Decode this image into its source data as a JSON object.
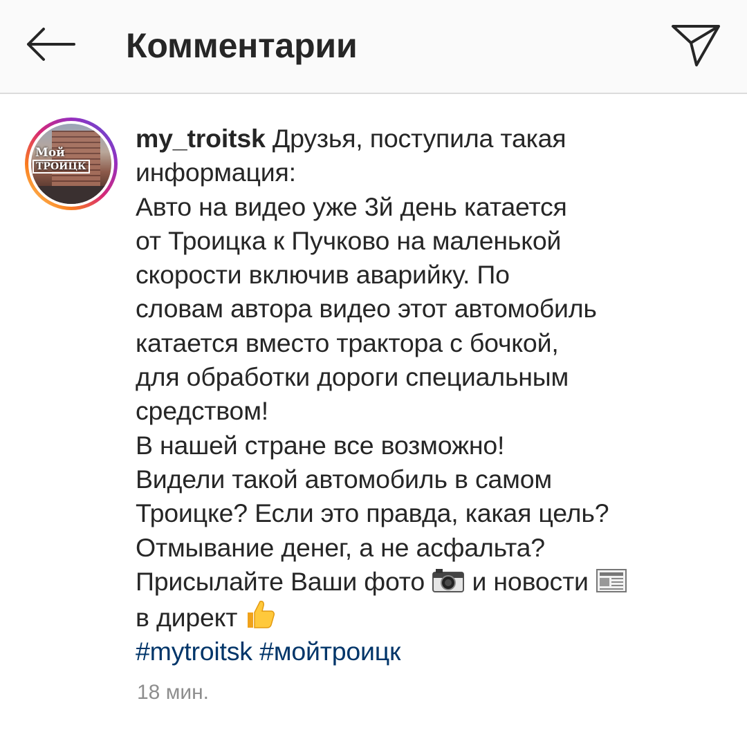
{
  "header": {
    "title": "Комментарии",
    "back_icon": "arrow-left-icon",
    "share_icon": "paper-plane-icon"
  },
  "avatar": {
    "logo_top": "Мой",
    "logo_bottom": "ТРОИЦК"
  },
  "comment": {
    "username": "my_troitsk",
    "lines": [
      "Друзья, поступила такая",
      "информация:",
      "Авто на видео уже 3й день катается",
      "от Троицка к Пучково на маленькой",
      "скорости включив аварийку. По",
      "словам автора видео этот автомобиль",
      "катается вместо трактора с бочкой,",
      "для обработки дороги специальным",
      "средством!",
      "В нашей стране все возможно!",
      "Видели такой автомобиль в самом",
      "Троицке? Если это правда, какая цель?",
      "Отмывание денег, а не асфальта?",
      "Присылайте Ваши фото",
      " и новости",
      "в директ"
    ],
    "hashtags": [
      "#mytroitsk",
      "#мойтроицк"
    ],
    "emojis": [
      "camera-icon",
      "newspaper-icon",
      "thumbs-up-icon"
    ],
    "timestamp": "18 мин."
  },
  "colors": {
    "header_bg": "#fafafa",
    "text": "#262626",
    "hashtag": "#003569",
    "muted": "#8e8e8e",
    "divider": "#dbdbdb"
  }
}
